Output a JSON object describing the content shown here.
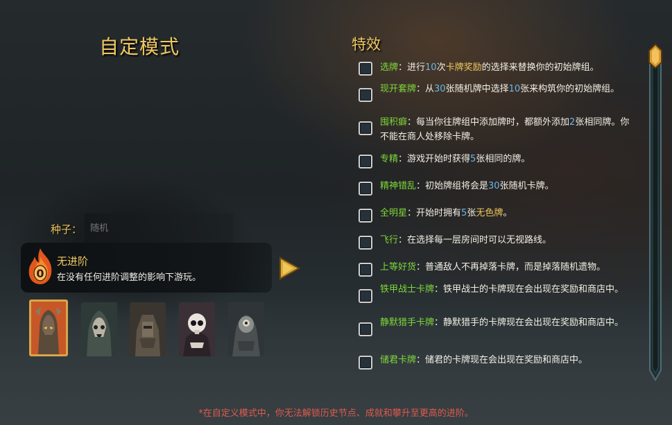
{
  "header": {
    "title": "自定模式"
  },
  "effects_section": {
    "title": "特效",
    "items": [
      {
        "name": "选牌",
        "segments": [
          [
            "：进行",
            ""
          ],
          [
            "10",
            "num"
          ],
          [
            "次",
            ""
          ],
          [
            "卡牌奖励",
            "gold"
          ],
          [
            "的选择来替换你的初始牌组。",
            ""
          ]
        ]
      },
      {
        "name": "现开套牌",
        "segments": [
          [
            "：从",
            ""
          ],
          [
            "30",
            "num"
          ],
          [
            "张随机牌中选择",
            ""
          ],
          [
            "10",
            "num"
          ],
          [
            "张来构筑你的初始牌组。",
            ""
          ]
        ]
      },
      {
        "name": "囤积癖",
        "segments": [
          [
            "：每当你往牌组中添加牌时，都额外添加",
            ""
          ],
          [
            "2",
            "num"
          ],
          [
            "张相同牌。你不能在商人处移除卡牌。",
            ""
          ]
        ]
      },
      {
        "name": "专精",
        "segments": [
          [
            "：游戏开始时获得",
            ""
          ],
          [
            "5",
            "num"
          ],
          [
            "张相同的牌。",
            ""
          ]
        ]
      },
      {
        "name": "精神错乱",
        "segments": [
          [
            "：初始牌组将会是",
            ""
          ],
          [
            "30",
            "num"
          ],
          [
            "张随机卡牌。",
            ""
          ]
        ]
      },
      {
        "name": "全明星",
        "segments": [
          [
            "：开始时拥有",
            ""
          ],
          [
            "5",
            "num"
          ],
          [
            "张",
            ""
          ],
          [
            "无色牌",
            "gold"
          ],
          [
            "。",
            ""
          ]
        ]
      },
      {
        "name": "飞行",
        "segments": [
          [
            "：在选择每一层房间时可以无视路线。",
            ""
          ]
        ]
      },
      {
        "name": "上等好货",
        "segments": [
          [
            "：普通敌人不再掉落卡牌，而是掉落随机遗物。",
            ""
          ]
        ]
      },
      {
        "name": "铁甲战士卡牌",
        "segments": [
          [
            "：铁甲战士的卡牌现在会出现在奖励和商店中。",
            ""
          ]
        ]
      },
      {
        "name": "静默猎手卡牌",
        "segments": [
          [
            "：静默猎手的卡牌现在会出现在奖励和商店中。",
            ""
          ]
        ]
      },
      {
        "name": "储君卡牌",
        "segments": [
          [
            "：储君的卡牌现在会出现在奖励和商店中。",
            ""
          ]
        ]
      }
    ]
  },
  "seed": {
    "label": "种子：",
    "placeholder": "随机"
  },
  "ascension": {
    "level": "0",
    "title": "无进阶",
    "description": "在没有任何进阶调整的影响下游玩。"
  },
  "characters": [
    {
      "icon": "ironclad-portrait-icon",
      "selected": true
    },
    {
      "icon": "silent-portrait-icon",
      "selected": false
    },
    {
      "icon": "defect-portrait-icon",
      "selected": false
    },
    {
      "icon": "skeleton-portrait-icon",
      "selected": false
    },
    {
      "icon": "watcher-portrait-icon",
      "selected": false
    }
  ],
  "footer": {
    "warning": "*在自定义模式中，你无法解锁历史节点、成就和攀升至更高的进阶。"
  },
  "colors": {
    "gold": "#efc860",
    "green": "#7fd83a",
    "blue": "#6bb9ea",
    "warning": "#e05a4e"
  }
}
